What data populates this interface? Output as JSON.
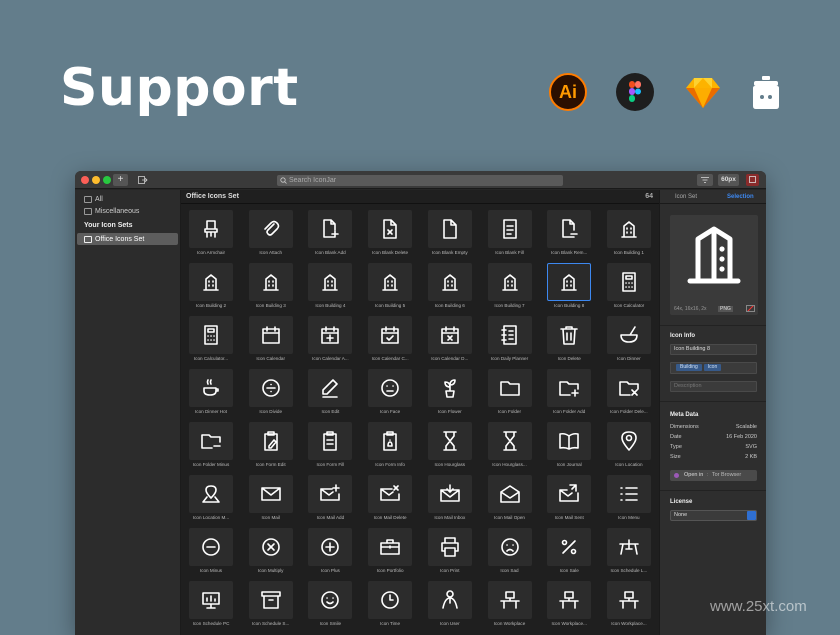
{
  "hero": {
    "title": "Support"
  },
  "tools": {
    "illustrator_label": "Ai"
  },
  "window": {
    "search_placeholder": "Search IconJar",
    "size_button": "60px",
    "add_label": "+"
  },
  "sidebar": {
    "all": "All",
    "misc": "Miscellaneous",
    "your_sets": "Your Icon Sets",
    "selected_set": "Office Icons Set"
  },
  "main": {
    "set_title": "Office Icons Set",
    "count": "64",
    "icons": [
      {
        "name": "Icon Armchair",
        "icon": "armchair-icon"
      },
      {
        "name": "Icon Attach",
        "icon": "attach-icon"
      },
      {
        "name": "Icon Blank Add",
        "icon": "blank-add-icon"
      },
      {
        "name": "Icon Blank Delete",
        "icon": "blank-delete-icon"
      },
      {
        "name": "Icon Blank Empty",
        "icon": "blank-empty-icon"
      },
      {
        "name": "Icon Blank Fill",
        "icon": "blank-fill-icon"
      },
      {
        "name": "Icon Blank Rem...",
        "icon": "blank-remove-icon"
      },
      {
        "name": "Icon Building 1",
        "icon": "building-icon"
      },
      {
        "name": "Icon Building 2",
        "icon": "building-icon"
      },
      {
        "name": "Icon Building 3",
        "icon": "building-icon"
      },
      {
        "name": "Icon Building 4",
        "icon": "building-icon"
      },
      {
        "name": "Icon Building 5",
        "icon": "building-icon"
      },
      {
        "name": "Icon Building 6",
        "icon": "building-icon"
      },
      {
        "name": "Icon Building 7",
        "icon": "building-icon"
      },
      {
        "name": "Icon Building 8",
        "icon": "building-icon"
      },
      {
        "name": "Icon Calculator",
        "icon": "calculator-icon"
      },
      {
        "name": "Icon Calculator...",
        "icon": "calculator-icon"
      },
      {
        "name": "Icon Calendar",
        "icon": "calendar-icon"
      },
      {
        "name": "Icon Calendar A...",
        "icon": "calendar-add-icon"
      },
      {
        "name": "Icon Calendar C...",
        "icon": "calendar-check-icon"
      },
      {
        "name": "Icon Calendar D...",
        "icon": "calendar-delete-icon"
      },
      {
        "name": "Icon Daily Planner",
        "icon": "planner-icon"
      },
      {
        "name": "Icon Delete",
        "icon": "trash-icon"
      },
      {
        "name": "Icon Dinner",
        "icon": "dinner-icon"
      },
      {
        "name": "Icon Dinner Hot",
        "icon": "cup-icon"
      },
      {
        "name": "Icon Divide",
        "icon": "divide-icon"
      },
      {
        "name": "Icon Edit",
        "icon": "pencil-icon"
      },
      {
        "name": "Icon Face",
        "icon": "face-icon"
      },
      {
        "name": "Icon Flower",
        "icon": "flower-icon"
      },
      {
        "name": "Icon Folder",
        "icon": "folder-icon"
      },
      {
        "name": "Icon Folder Add",
        "icon": "folder-add-icon"
      },
      {
        "name": "Icon Folder Dele...",
        "icon": "folder-delete-icon"
      },
      {
        "name": "Icon Folder Minus",
        "icon": "folder-minus-icon"
      },
      {
        "name": "Icon Form Edit",
        "icon": "form-edit-icon"
      },
      {
        "name": "Icon Form Fill",
        "icon": "form-icon"
      },
      {
        "name": "Icon Form Info",
        "icon": "form-info-icon"
      },
      {
        "name": "Icon Hourglass",
        "icon": "hourglass-icon"
      },
      {
        "name": "Icon Hourglass...",
        "icon": "hourglass-icon"
      },
      {
        "name": "Icon Journal",
        "icon": "journal-icon"
      },
      {
        "name": "Icon Location",
        "icon": "location-icon"
      },
      {
        "name": "Icon Location M...",
        "icon": "location-map-icon"
      },
      {
        "name": "Icon Mail",
        "icon": "mail-icon"
      },
      {
        "name": "Icon Mail Add",
        "icon": "mail-add-icon"
      },
      {
        "name": "Icon Mail Delete",
        "icon": "mail-delete-icon"
      },
      {
        "name": "Icon Mail Inbox",
        "icon": "mail-inbox-icon"
      },
      {
        "name": "Icon Mail Open",
        "icon": "mail-open-icon"
      },
      {
        "name": "Icon Mail Sent",
        "icon": "mail-sent-icon"
      },
      {
        "name": "Icon Menu",
        "icon": "menu-icon"
      },
      {
        "name": "Icon Minus",
        "icon": "minus-circle-icon"
      },
      {
        "name": "Icon Multiply",
        "icon": "multiply-circle-icon"
      },
      {
        "name": "Icon Plus",
        "icon": "plus-circle-icon"
      },
      {
        "name": "Icon Portfolio",
        "icon": "portfolio-icon"
      },
      {
        "name": "Icon Print",
        "icon": "print-icon"
      },
      {
        "name": "Icon Sad",
        "icon": "sad-icon"
      },
      {
        "name": "Icon Sale",
        "icon": "percent-icon"
      },
      {
        "name": "Icon Schedule L...",
        "icon": "easel-icon"
      },
      {
        "name": "Icon Schedule PC",
        "icon": "monitor-icon"
      },
      {
        "name": "Icon Schedule S...",
        "icon": "archive-icon"
      },
      {
        "name": "Icon Smile",
        "icon": "smile-icon"
      },
      {
        "name": "Icon Time",
        "icon": "clock-icon"
      },
      {
        "name": "Icon User",
        "icon": "user-icon"
      },
      {
        "name": "Icon Workplace",
        "icon": "workplace-icon"
      },
      {
        "name": "Icon Workplace...",
        "icon": "workplace-icon"
      },
      {
        "name": "Icon Workplace...",
        "icon": "workplace-icon"
      }
    ]
  },
  "right": {
    "tab_set": "Icon Set",
    "tab_selection": "Selection",
    "preview_sizes": "64x, 16x16, 2x",
    "preview_format": "PNG",
    "info_title": "Icon Info",
    "icon_name": "Icon Building 8",
    "tags": [
      "Building",
      "Icon"
    ],
    "description_placeholder": "Description",
    "meta_title": "Meta Data",
    "meta": [
      {
        "k": "Dimensions",
        "v": "Scalable"
      },
      {
        "k": "Date",
        "v": "16 Feb 2020"
      },
      {
        "k": "Type",
        "v": "SVG"
      },
      {
        "k": "Size",
        "v": "2 KB"
      }
    ],
    "open_in": "Open in",
    "open_app": "Tor Browser",
    "license_title": "License",
    "license_value": "None"
  },
  "watermark": "www.25xt.com",
  "colors": {
    "background": "#637d8b",
    "accent": "#3d88f0",
    "ai_orange": "#ff7c00"
  }
}
